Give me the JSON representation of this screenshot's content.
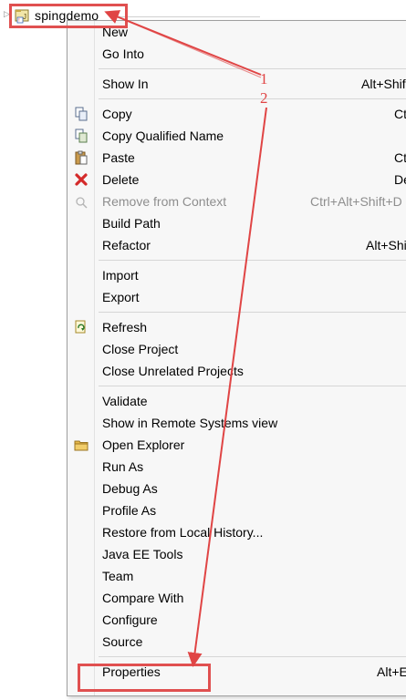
{
  "project": {
    "name": "spingdemo"
  },
  "annotations": {
    "step1": "1",
    "step2": "2",
    "color": "#e04545"
  },
  "menu": {
    "groups": [
      [
        {
          "label": "New",
          "shortcut": ""
        },
        {
          "label": "Go Into",
          "shortcut": ""
        }
      ],
      [
        {
          "label": "Show In",
          "shortcut": "Alt+Shif"
        }
      ],
      [
        {
          "label": "Copy",
          "shortcut": "Ct",
          "icon": "copy-icon"
        },
        {
          "label": "Copy Qualified Name",
          "shortcut": "",
          "icon": "copy-qualified-name-icon"
        },
        {
          "label": "Paste",
          "shortcut": "Ct",
          "icon": "paste-icon"
        },
        {
          "label": "Delete",
          "shortcut": "De",
          "icon": "delete-icon"
        },
        {
          "label": "Remove from Context",
          "shortcut": "Ctrl+Alt+Shift+D",
          "icon": "remove-from-context-icon",
          "disabled": true
        },
        {
          "label": "Build Path",
          "shortcut": ""
        },
        {
          "label": "Refactor",
          "shortcut": "Alt+Shi"
        }
      ],
      [
        {
          "label": "Import",
          "shortcut": ""
        },
        {
          "label": "Export",
          "shortcut": ""
        }
      ],
      [
        {
          "label": "Refresh",
          "shortcut": "",
          "icon": "refresh-icon"
        },
        {
          "label": "Close Project",
          "shortcut": ""
        },
        {
          "label": "Close Unrelated Projects",
          "shortcut": ""
        }
      ],
      [
        {
          "label": "Validate",
          "shortcut": ""
        },
        {
          "label": "Show in Remote Systems view",
          "shortcut": ""
        },
        {
          "label": "Open Explorer",
          "shortcut": "",
          "icon": "folder-icon"
        },
        {
          "label": "Run As",
          "shortcut": ""
        },
        {
          "label": "Debug As",
          "shortcut": ""
        },
        {
          "label": "Profile As",
          "shortcut": ""
        },
        {
          "label": "Restore from Local History...",
          "shortcut": ""
        },
        {
          "label": "Java EE Tools",
          "shortcut": ""
        },
        {
          "label": "Team",
          "shortcut": ""
        },
        {
          "label": "Compare With",
          "shortcut": ""
        },
        {
          "label": "Configure",
          "shortcut": ""
        },
        {
          "label": "Source",
          "shortcut": ""
        }
      ],
      [
        {
          "label": "Properties",
          "shortcut": "Alt+E"
        }
      ]
    ]
  }
}
